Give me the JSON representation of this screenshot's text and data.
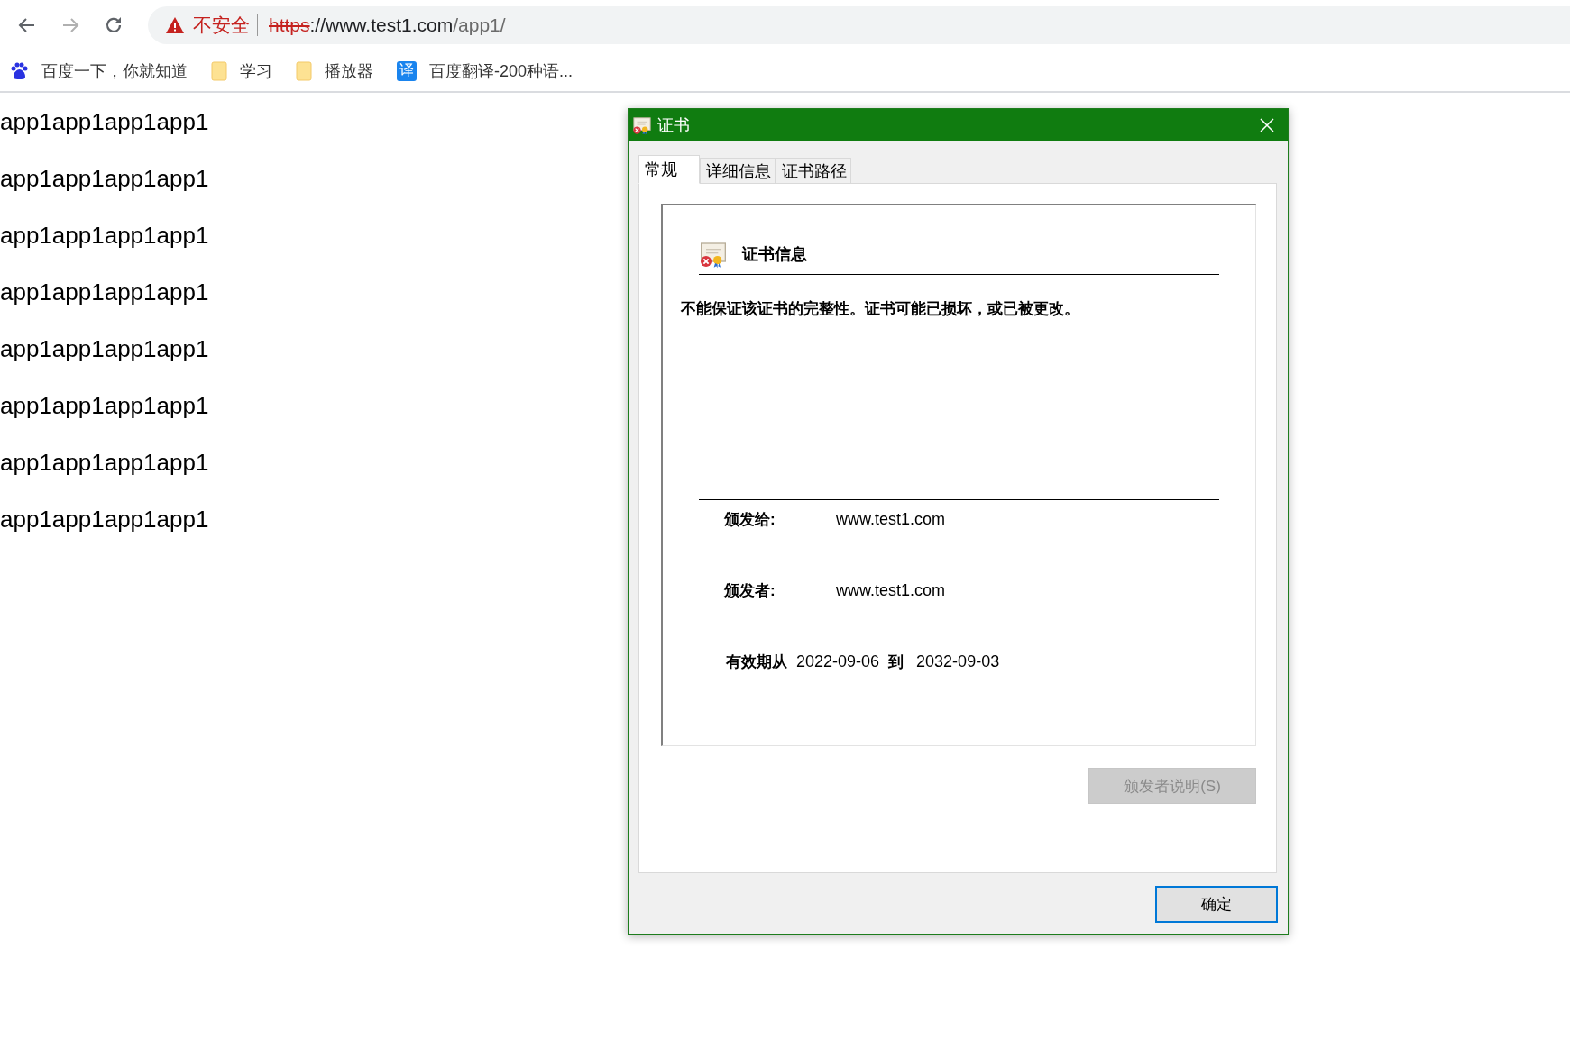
{
  "browser": {
    "security_label": "不安全",
    "url": {
      "scheme": "https",
      "host": "://www.test1.com",
      "path": "/app1/"
    },
    "bookmarks": [
      {
        "kind": "baidu",
        "label": "百度一下，你就知道"
      },
      {
        "kind": "folder",
        "label": "学习"
      },
      {
        "kind": "folder",
        "label": "播放器"
      },
      {
        "kind": "translate",
        "icon_text": "译",
        "label": "百度翻译-200种语..."
      }
    ]
  },
  "page": {
    "lines": [
      "app1app1app1app1",
      "app1app1app1app1",
      "app1app1app1app1",
      "app1app1app1app1",
      "app1app1app1app1",
      "app1app1app1app1",
      "app1app1app1app1",
      "app1app1app1app1"
    ]
  },
  "dialog": {
    "title": "证书",
    "tabs": [
      {
        "label": "常规",
        "selected": true
      },
      {
        "label": "详细信息",
        "selected": false
      },
      {
        "label": "证书路径",
        "selected": false
      }
    ],
    "section_title": "证书信息",
    "message": "不能保证该证书的完整性。证书可能已损坏，或已被更改。",
    "issued_to": {
      "label": "颁发给:",
      "value": "www.test1.com"
    },
    "issued_by": {
      "label": "颁发者:",
      "value": "www.test1.com"
    },
    "validity": {
      "label": "有效期从",
      "from": "2022-09-06",
      "to_label": "到",
      "to": "2032-09-03"
    },
    "issuer_statement_button": {
      "label": "颁发者说明(S)",
      "disabled": true
    },
    "ok_button": {
      "label": "确定",
      "focused": true
    }
  }
}
